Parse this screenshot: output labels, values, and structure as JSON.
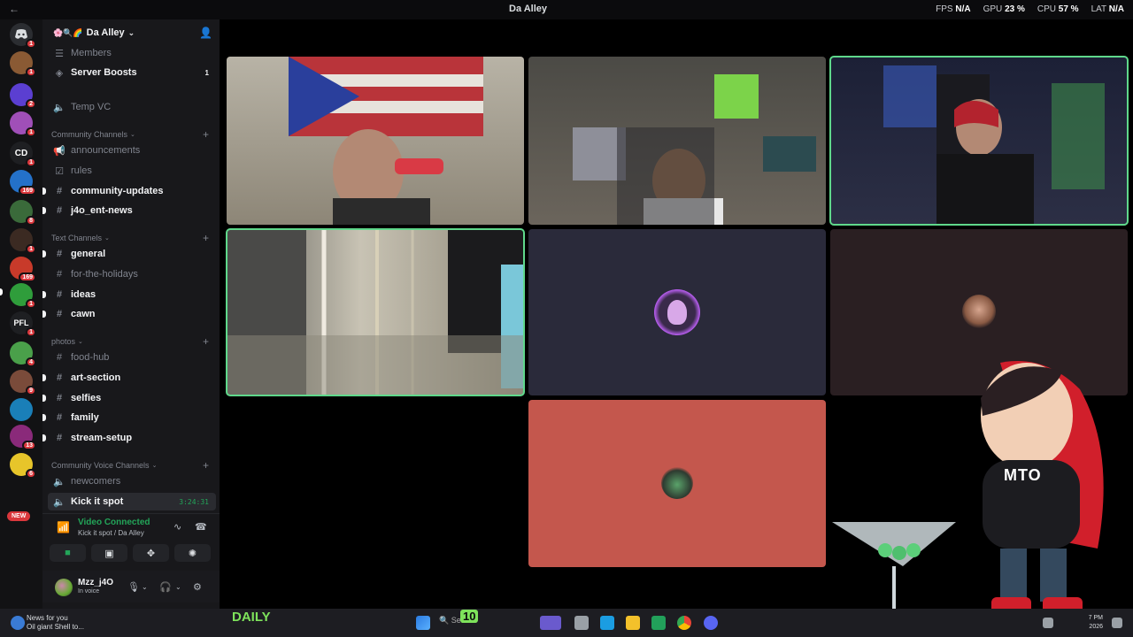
{
  "titlebar": {
    "back_icon": "back-arrow-icon",
    "title": "Da Alley",
    "fps_label": "FPS",
    "fps_value": "N/A",
    "gpu_label": "GPU",
    "gpu_value": "23 %",
    "cpu_label": "CPU",
    "cpu_value": "57 %",
    "lat_label": "LAT",
    "lat_value": "N/A"
  },
  "rail": {
    "servers": [
      {
        "label": "",
        "badge": "1"
      },
      {
        "label": "",
        "badge": "1"
      },
      {
        "label": "",
        "badge": "2"
      },
      {
        "label": "",
        "badge": "1"
      },
      {
        "label": "CD",
        "badge": "1"
      },
      {
        "label": "",
        "badge": "169"
      },
      {
        "label": "",
        "badge": "8"
      },
      {
        "label": "",
        "badge": "1"
      },
      {
        "label": "",
        "badge": "169"
      },
      {
        "label": "",
        "badge": "1"
      },
      {
        "label": "PFL",
        "badge": "1"
      },
      {
        "label": "",
        "badge": "4"
      },
      {
        "label": "",
        "badge": "9"
      },
      {
        "label": "",
        "badge": ""
      },
      {
        "label": "",
        "badge": "13"
      },
      {
        "label": "",
        "badge": "6"
      }
    ],
    "new_tag": "NEW"
  },
  "sidebar": {
    "server_name": "Da Alley",
    "members": "Members",
    "server_boosts": "Server Boosts",
    "server_boosts_count": "1",
    "temp_vc": "Temp VC",
    "categories": {
      "community": "Community Channels",
      "text": "Text Channels",
      "photos": "photos",
      "voice": "Community Voice Channels"
    },
    "channels": {
      "announcements": "announcements",
      "rules": "rules",
      "community_updates": "community-updates",
      "j4o_ent_news": "j4o_ent-news",
      "general": "general",
      "for_the_holidays": "for-the-holidays",
      "ideas": "ideas",
      "cawn": "cawn",
      "food_hub": "food-hub",
      "art_section": "art-section",
      "selfies": "selfies",
      "family": "family",
      "stream_setup": "stream-setup",
      "newcomers": "newcomers",
      "kick_it_spot": "Kick it spot",
      "kick_it_timer": "3:24:31"
    }
  },
  "voice": {
    "status": "Video Connected",
    "location": "Kick it spot / Da Alley"
  },
  "user": {
    "name": "Mzz_j4O",
    "status": "In voice"
  },
  "overlay": {
    "label": "MTO"
  },
  "taskbar": {
    "news_line1": "News for you",
    "news_line2": "Oil giant Shell to...",
    "daily": "DAILY",
    "ten": "10",
    "search": "Search",
    "time": "7 PM",
    "date": "2026"
  }
}
